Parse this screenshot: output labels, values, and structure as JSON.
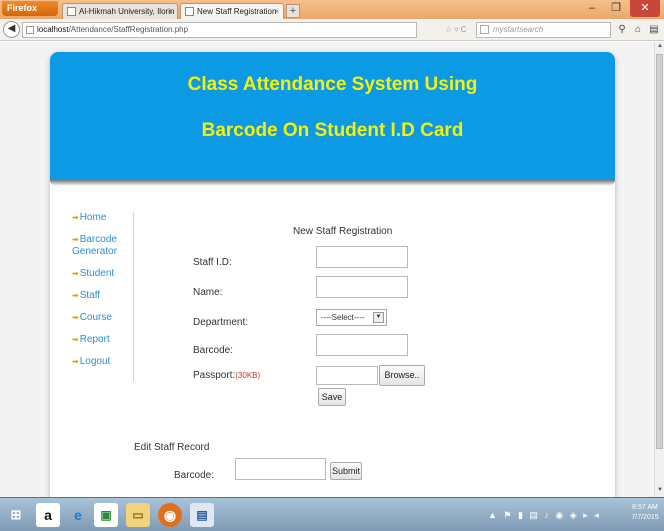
{
  "browser": {
    "firefox_button": "Firefox",
    "tabs": [
      {
        "title": "Al-Hikmah University, Ilorin - Nigeria..."
      },
      {
        "title": "New Staff Registration"
      }
    ],
    "url_host": "localhost",
    "url_path": "/Attendance/StaffRegistration.php",
    "search_placeholder": "mystartsearch"
  },
  "banner": {
    "line1": "Class Attendance System Using",
    "line2": "Barcode On Student I.D Card",
    "bg_color": "#0d9ae5",
    "text_color": "#f4f20a"
  },
  "sidebar": {
    "items": [
      {
        "label": "Home"
      },
      {
        "label": "Barcode Generator"
      },
      {
        "label": "Student"
      },
      {
        "label": "Staff"
      },
      {
        "label": "Course"
      },
      {
        "label": "Report"
      },
      {
        "label": "Logout"
      }
    ]
  },
  "form": {
    "title": "New Staff Registration",
    "staff_id_label": "Staff I.D:",
    "name_label": "Name:",
    "department_label": "Department:",
    "department_value": "----Select----",
    "barcode_label": "Barcode:",
    "passport_label": "Passport:",
    "passport_hint": "(30KB)",
    "browse_label": "Browse..",
    "save_label": "Save"
  },
  "edit": {
    "title": "Edit Staff Record",
    "barcode_label": "Barcode:",
    "submit_label": "Submit"
  },
  "taskbar": {
    "time": "8:57 AM",
    "date": "7/7/2015"
  }
}
